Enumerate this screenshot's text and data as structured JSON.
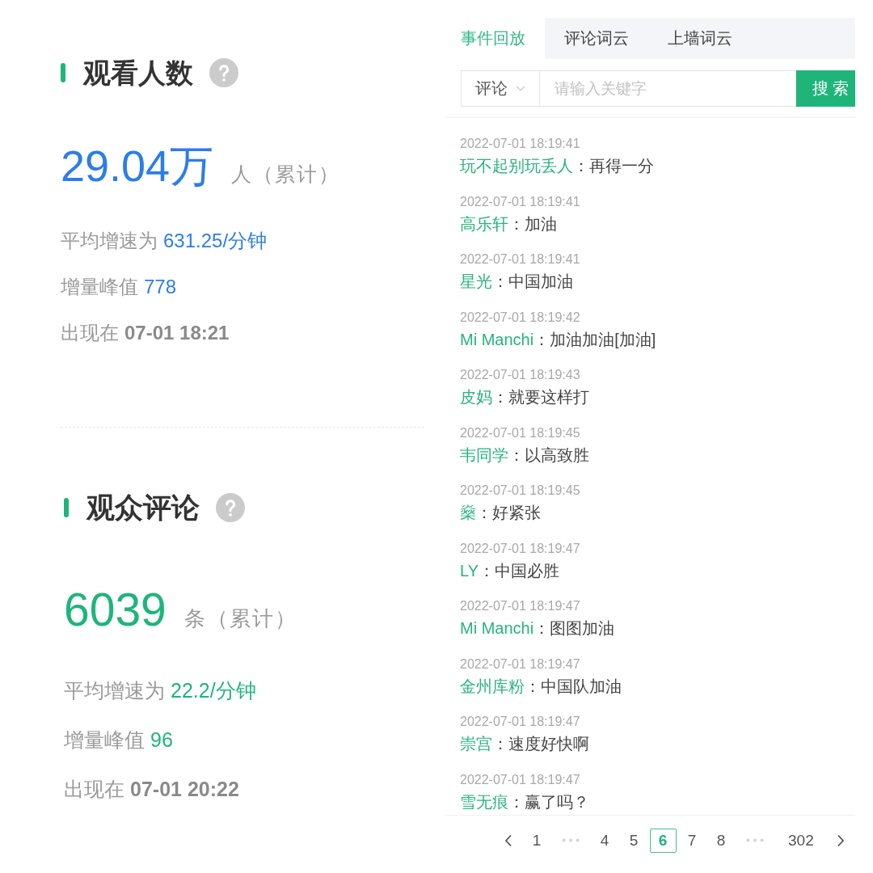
{
  "stats": [
    {
      "title": "观看人数",
      "value": "29.04万",
      "unit": "人（累计）",
      "color": "#2b7de9",
      "lines": [
        {
          "kind": "accent",
          "label": "平均增速为",
          "value": "631.25/分钟"
        },
        {
          "kind": "accent",
          "label": "增量峰值",
          "value": "778"
        },
        {
          "kind": "strong",
          "label": "出现在",
          "value": "07-01 18:21"
        }
      ]
    },
    {
      "title": "观众评论",
      "value": "6039",
      "unit": "条（累计）",
      "color": "#1fb57a",
      "lines": [
        {
          "kind": "accent",
          "label": "平均增速为",
          "value": "22.2/分钟"
        },
        {
          "kind": "accent",
          "label": "增量峰值",
          "value": "96"
        },
        {
          "kind": "strong",
          "label": "出现在",
          "value": "07-01 20:22"
        }
      ]
    }
  ],
  "tabs": [
    {
      "label": "事件回放",
      "selected": true
    },
    {
      "label": "评论词云",
      "selected": false
    },
    {
      "label": "上墙词云",
      "selected": false
    }
  ],
  "search": {
    "filter": "评论",
    "placeholder": "请输入关键字",
    "button": "搜 索"
  },
  "comments": [
    {
      "time": "2022-07-01 18:19:41",
      "user": "玩不起别玩丢人",
      "text": "：再得一分"
    },
    {
      "time": "2022-07-01 18:19:41",
      "user": "高乐轩",
      "text": "：加油"
    },
    {
      "time": "2022-07-01 18:19:41",
      "user": "星光",
      "text": "：中国加油"
    },
    {
      "time": "2022-07-01 18:19:42",
      "user": "Mi Manchi",
      "text": "：加油加油[加油]"
    },
    {
      "time": "2022-07-01 18:19:43",
      "user": "皮妈",
      "text": "：就要这样打"
    },
    {
      "time": "2022-07-01 18:19:45",
      "user": "韦同学",
      "text": "：以高致胜"
    },
    {
      "time": "2022-07-01 18:19:45",
      "user": "燊",
      "text": "：好紧张"
    },
    {
      "time": "2022-07-01 18:19:47",
      "user": "LY",
      "text": "：中国必胜"
    },
    {
      "time": "2022-07-01 18:19:47",
      "user": "Mi Manchi",
      "text": "：图图加油"
    },
    {
      "time": "2022-07-01 18:19:47",
      "user": "金州库粉",
      "text": "：中国队加油"
    },
    {
      "time": "2022-07-01 18:19:47",
      "user": "崇宫",
      "text": "：速度好快啊"
    },
    {
      "time": "2022-07-01 18:19:47",
      "user": "雪无痕",
      "text": "：赢了吗？"
    }
  ],
  "pagination": [
    {
      "kind": "page",
      "label": "1",
      "selected": false
    },
    {
      "kind": "ellipsis",
      "selected": false
    },
    {
      "kind": "page",
      "label": "4",
      "selected": false
    },
    {
      "kind": "page",
      "label": "5",
      "selected": false
    },
    {
      "kind": "page",
      "label": "6",
      "selected": true
    },
    {
      "kind": "page",
      "label": "7",
      "selected": false
    },
    {
      "kind": "page",
      "label": "8",
      "selected": false
    },
    {
      "kind": "ellipsis",
      "selected": false
    },
    {
      "kind": "page",
      "label": "302",
      "selected": false
    }
  ]
}
